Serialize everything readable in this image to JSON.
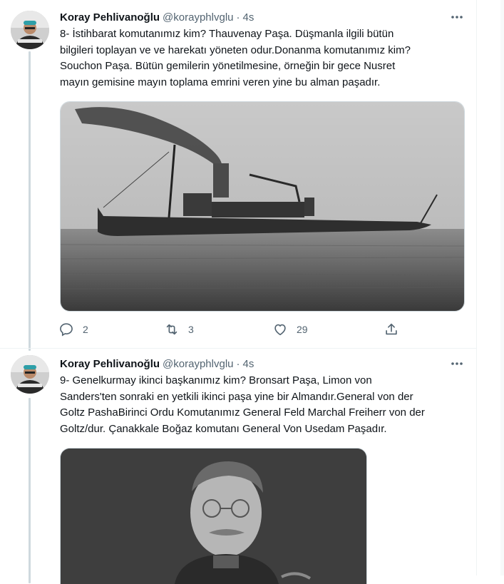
{
  "tweets": [
    {
      "author_name": "Koray Pehlivanoğlu",
      "handle": "@korayphlvglu",
      "dot": "·",
      "time": "4s",
      "text": "8- İstihbarat komutanımız kim? Thauvenay Paşa. Düşmanla ilgili bütün\nbilgileri toplayan ve ve harekatı yöneten odur.Donanma komutanımız kim?\nSouchon Paşa. Bütün gemilerin yönetilmesine, örneğin bir gece Nusret\nmayın gemisine mayın toplama emrini veren yine bu alman paşadır.",
      "actions": {
        "reply_count": "2",
        "retweet_count": "3",
        "like_count": "29"
      }
    },
    {
      "author_name": "Koray Pehlivanoğlu",
      "handle": "@korayphlvglu",
      "dot": "·",
      "time": "4s",
      "text": "9- Genelkurmay ikinci başkanımız kim? Bronsart Paşa, Limon von\nSanders'ten sonraki en yetkili ikinci paşa yine bir Almandır.General von der\nGoltz PashaBirinci Ordu Komutanımız General Feld Marchal Freiherr von der\nGoltz/dur. Çanakkale Boğaz komutanı General Von Usedam Paşadır."
    }
  ],
  "icons": {
    "more": "more-icon",
    "reply": "reply-icon",
    "retweet": "retweet-icon",
    "like": "like-icon",
    "share": "share-icon"
  },
  "colors": {
    "text": "#0f1419",
    "secondary": "#536471",
    "thread_line": "#cfd9de"
  }
}
